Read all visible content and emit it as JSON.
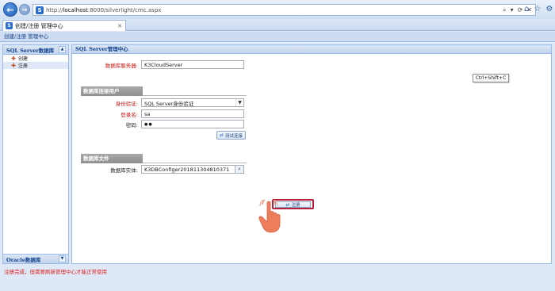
{
  "browser": {
    "url_prefix": "http://",
    "url_host": "localhost",
    "url_path": ":8000/silverlight/cmc.aspx",
    "tab_title": "创建/注册 管理中心",
    "search_glyph": "⌕",
    "dropdown_glyph": "▾",
    "refresh_glyph": "⟳",
    "close_glyph": "✕",
    "home_icon": "⌂",
    "favorites_icon": "☆",
    "settings_icon": "⚙"
  },
  "app": {
    "header": "创建/注册 管理中心"
  },
  "sidebar": {
    "sql_title": "SQL Server数据库",
    "items": [
      {
        "label": "创建",
        "icon": "create-icon"
      },
      {
        "label": "注册",
        "icon": "register-icon"
      }
    ],
    "oracle_title": "Oracle数据库"
  },
  "main": {
    "title": "SQL Server管理中心",
    "server_label": "数据库服务器:",
    "server_value": "K3CloudServer",
    "conn_section": "数据库连接用户",
    "auth_label": "身份验证:",
    "auth_value": "SQL Server身份验证",
    "login_label": "登录名:",
    "login_value": "sa",
    "password_label": "密码:",
    "password_value": "●●",
    "test_button": "测试连接",
    "file_section": "数据库文件",
    "entity_label": "数据库实体:",
    "entity_value": "K3DBConfiger201811304810371",
    "register_button": "注册",
    "tooltip": "Ctrl+Shift+C"
  },
  "status": {
    "message": "注册完成，但需要刷新管理中心才能正常使用"
  },
  "colors": {
    "required_label": "#cc1111",
    "register_highlight": "#b8203c",
    "status_text": "#dd1f1f",
    "panel_border": "#99bbe8"
  }
}
